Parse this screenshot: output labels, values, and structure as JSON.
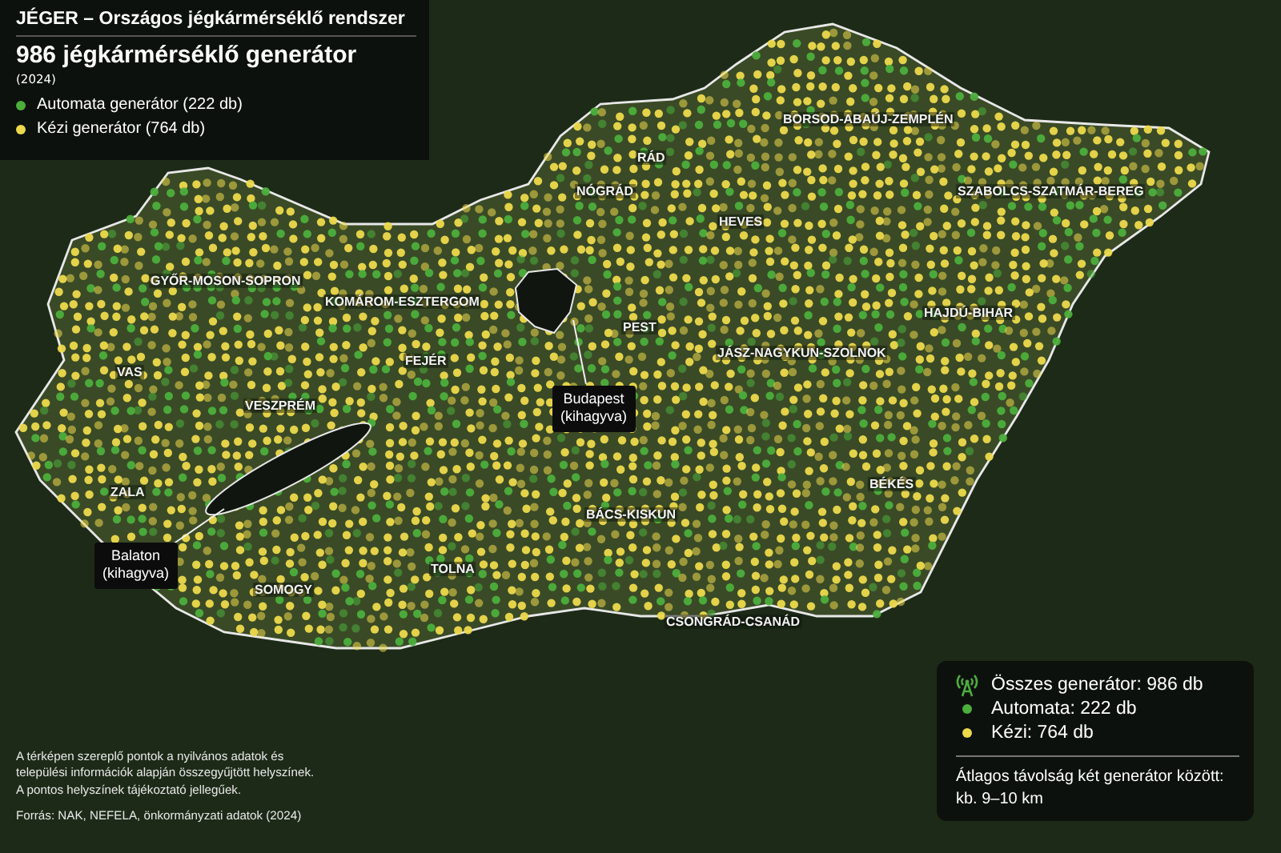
{
  "header": {
    "title": "JÉGER – Országos jégkármérséklő rendszer",
    "subtitle": "986 jégkármérséklő generátor",
    "year": "(2024)",
    "legend": [
      {
        "label": "Automata generátor (222 db)",
        "color": "#4cae3c"
      },
      {
        "label": "Kézi generátor (764 db)",
        "color": "#ecd94c"
      }
    ]
  },
  "map": {
    "regions": [
      "BORSOD-ABAÚJ-ZEMPLÉN",
      "RÁD",
      "NÓGRÁD",
      "SZABOLCS-SZATMÁR-BEREG",
      "HEVES",
      "GYŐR-MOSON-SOPRON",
      "KOMÁROM-ESZTERGOM",
      "HAJDÚ-BIHAR",
      "PEST",
      "JÁSZ-NAGYKUN-SZOLNOK",
      "FEJÉR",
      "VAS",
      "VESZPRÉM",
      "BÉKÉS",
      "ZALA",
      "BÁCS-KISKUN",
      "TOLNA",
      "SOMOGY",
      "CSONGRÁD-CSANÁD"
    ],
    "callouts": [
      {
        "kind": "budapest",
        "lines": [
          "Budapest",
          "(kihagyva)"
        ]
      },
      {
        "kind": "balaton",
        "lines": [
          "Balaton",
          "(kihagyva)"
        ]
      }
    ]
  },
  "note": {
    "disclaimer_lines": [
      "A térképen szereplő pontok a nyilvános adatok és",
      "települési információk alapján összegyűjtött helyszínek.",
      "A pontos helyszínek tájékoztató jellegűek."
    ],
    "source": "Forrás: NAK, NEFELA, önkormányzati adatok (2024)"
  },
  "summary": {
    "total": "Összes generátor: 986 db",
    "items": [
      {
        "label": "Automata: 222 db",
        "color": "#4cae3c"
      },
      {
        "label": "Kézi: 764 db",
        "color": "#ecd94c"
      }
    ],
    "distance_lines": [
      "Átlagos távolság két generátor között:",
      "kb. 9–10 km"
    ]
  }
}
